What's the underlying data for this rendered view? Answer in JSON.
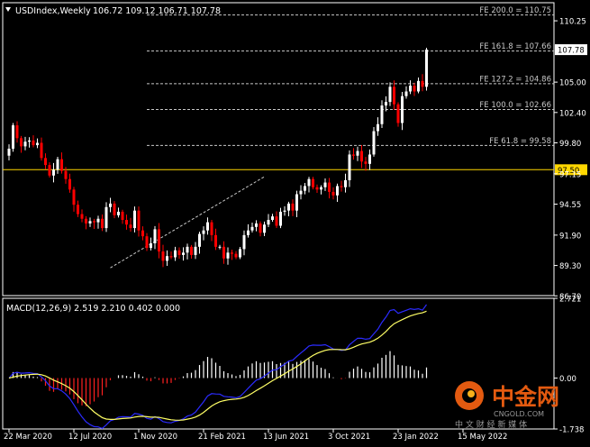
{
  "header": {
    "symbol": "USDIndex,Weekly",
    "ohlc": "106.72 109.12 106.71 107.78"
  },
  "macd_header": "MACD(12,26,9) 2.519 2.210 0.402 0.000",
  "chart_data": {
    "type": "candlestick",
    "colors": {
      "background": "#000000",
      "bull": "#FFFFFF",
      "bear": "#FF0000",
      "fib": "#C8C8C8",
      "hline": "#FFD700",
      "macd_line": "#2B2BFF",
      "signal_line": "#FFFF66",
      "hist_pos": "#FFFFFF",
      "hist_neg": "#FF2020",
      "axis": "#FFFFFF"
    },
    "price_axis": {
      "range": [
        86.72,
        111.8
      ],
      "ticks": [
        "110.25",
        "105.00",
        "102.40",
        "99.80",
        "97.15",
        "94.55",
        "91.90",
        "89.30",
        "86.70"
      ]
    },
    "last_price": "107.78",
    "hline": {
      "value": 97.5,
      "label": "97.50"
    },
    "fib_levels": [
      {
        "label": "FE 200.0 = 110.75",
        "value": 110.75
      },
      {
        "label": "FE 161.8 = 107.66",
        "value": 107.66
      },
      {
        "label": "FE 127.2 = 104.86",
        "value": 104.86
      },
      {
        "label": "FE 100.0 = 102.66",
        "value": 102.66
      },
      {
        "label": "FE 61.8 = 99.58",
        "value": 99.58
      }
    ],
    "trendline": {
      "from_week": 25,
      "from_price": 89.1,
      "to_week": 63,
      "to_price": 96.9
    },
    "x_labels": [
      "22 Mar 2020",
      "12 Jul 2020",
      "1 Nov 2020",
      "21 Feb 2021",
      "13 Jun 2021",
      "3 Oct 2021",
      "23 Jan 2022",
      "15 May 2022"
    ],
    "x_label_weeks": [
      0,
      16,
      32,
      48,
      64,
      80,
      96,
      112
    ],
    "closes": [
      99.3,
      101.3,
      100.2,
      99.5,
      99.9,
      100.0,
      99.6,
      99.8,
      98.5,
      97.9,
      97.0,
      97.5,
      98.4,
      97.4,
      96.7,
      95.8,
      94.5,
      93.7,
      93.3,
      92.9,
      93.1,
      93.0,
      93.3,
      92.5,
      94.3,
      94.6,
      93.6,
      93.9,
      93.2,
      92.8,
      92.5,
      94.0,
      92.3,
      91.8,
      90.8,
      91.2,
      92.4,
      90.5,
      89.7,
      90.1,
      90.0,
      90.6,
      90.2,
      90.4,
      90.9,
      90.2,
      90.9,
      92.0,
      92.3,
      93.0,
      91.9,
      90.9,
      90.9,
      89.9,
      90.4,
      90.3,
      90.0,
      90.7,
      91.9,
      92.3,
      92.6,
      92.9,
      92.1,
      92.8,
      93.2,
      93.5,
      92.7,
      93.9,
      94.0,
      94.6,
      94.0,
      95.4,
      95.7,
      96.1,
      96.7,
      96.0,
      95.8,
      96.0,
      96.4,
      95.6,
      95.3,
      96.1,
      96.0,
      96.6,
      98.8,
      98.7,
      99.1,
      98.2,
      98.0,
      98.8,
      100.8,
      101.4,
      103.0,
      103.3,
      104.6,
      103.1,
      101.5,
      103.8,
      104.2,
      104.7,
      104.2,
      105.1,
      104.6,
      107.78
    ]
  },
  "macd_chart": {
    "range": [
      -1.738,
      2.721
    ],
    "ticks": [
      "2.721",
      "0.00",
      "-1.738"
    ]
  },
  "watermark": {
    "text": "中金网",
    "url": "CNGOLD.COM",
    "tagline": "中 文 财 经 新 媒 体"
  }
}
